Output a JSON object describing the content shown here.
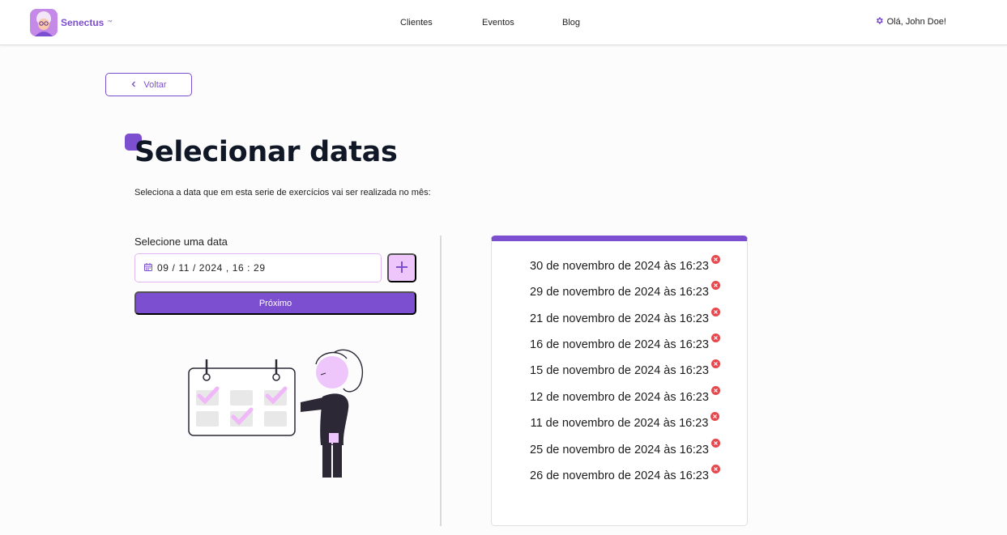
{
  "brand": {
    "name": "Senectus",
    "tm": "™"
  },
  "nav": {
    "links": [
      "Clientes",
      "Eventos",
      "Blog"
    ]
  },
  "user": {
    "greeting": "Olá, John Doe!"
  },
  "back_button": {
    "label": "Voltar"
  },
  "page": {
    "title": "Selecionar datas",
    "subtitle": "Seleciona a data que em esta serie de exercícios vai ser realizada no mês:"
  },
  "form": {
    "label": "Selecione uma data",
    "date_value": "09 / 11 / 2024 , 16 : 29",
    "next_label": "Próximo"
  },
  "selected_dates": [
    "30 de novembro de 2024 às 16:23",
    "29 de novembro de 2024 às 16:23",
    "21 de novembro de 2024 às 16:23",
    "16 de novembro de 2024 às 16:23",
    "15 de novembro de 2024 às 16:23",
    "12 de novembro de 2024 às 16:23",
    "11 de novembro de 2024 às 16:23",
    "25 de novembro de 2024 às 16:23",
    "26 de novembro de 2024 às 16:23"
  ],
  "colors": {
    "accent": "#7c4fd0",
    "accent_light": "#efc6fb",
    "danger": "#e5484d"
  },
  "icons": {
    "settings": "gear-icon",
    "back": "chevron-left-icon",
    "calendar": "calendar-icon",
    "add": "plus-icon",
    "remove": "close-circle-icon"
  }
}
